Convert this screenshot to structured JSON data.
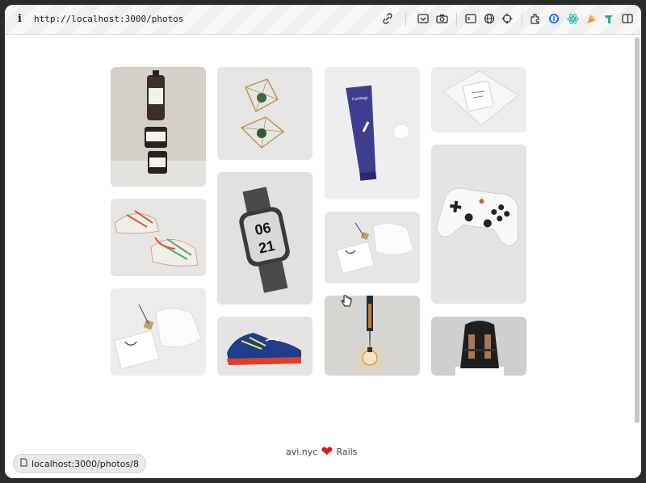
{
  "browser": {
    "url": "http://localhost:3000/photos",
    "icons": [
      "info-icon",
      "link-icon",
      "screenshot-icon",
      "camera-icon",
      "terminal-icon",
      "globe-icon",
      "crosshair-icon",
      "extension-icon",
      "password-icon",
      "react-devtools-icon",
      "extension-icon-2",
      "extension-icon-3",
      "sidebar-icon"
    ]
  },
  "gallery": {
    "photos": [
      {
        "subject": "supplement bottles"
      },
      {
        "subject": "geometric plant holders"
      },
      {
        "subject": "blue cream tube"
      },
      {
        "subject": "white box in plastic"
      },
      {
        "subject": "sneakers"
      },
      {
        "subject": "smart watch"
      },
      {
        "subject": "pouch and card"
      },
      {
        "subject": "game controller"
      },
      {
        "subject": "pouch and card"
      },
      {
        "subject": "blue sneaker"
      },
      {
        "subject": "hanging light bulb"
      },
      {
        "subject": "black backpack"
      }
    ],
    "watch_time": {
      "hour": "06",
      "minute": "21"
    }
  },
  "footer": {
    "left": "avi.nyc",
    "right": "Rails",
    "heart_color": "#e41818"
  },
  "status_bar": {
    "url": "localhost:3000/photos/8"
  }
}
